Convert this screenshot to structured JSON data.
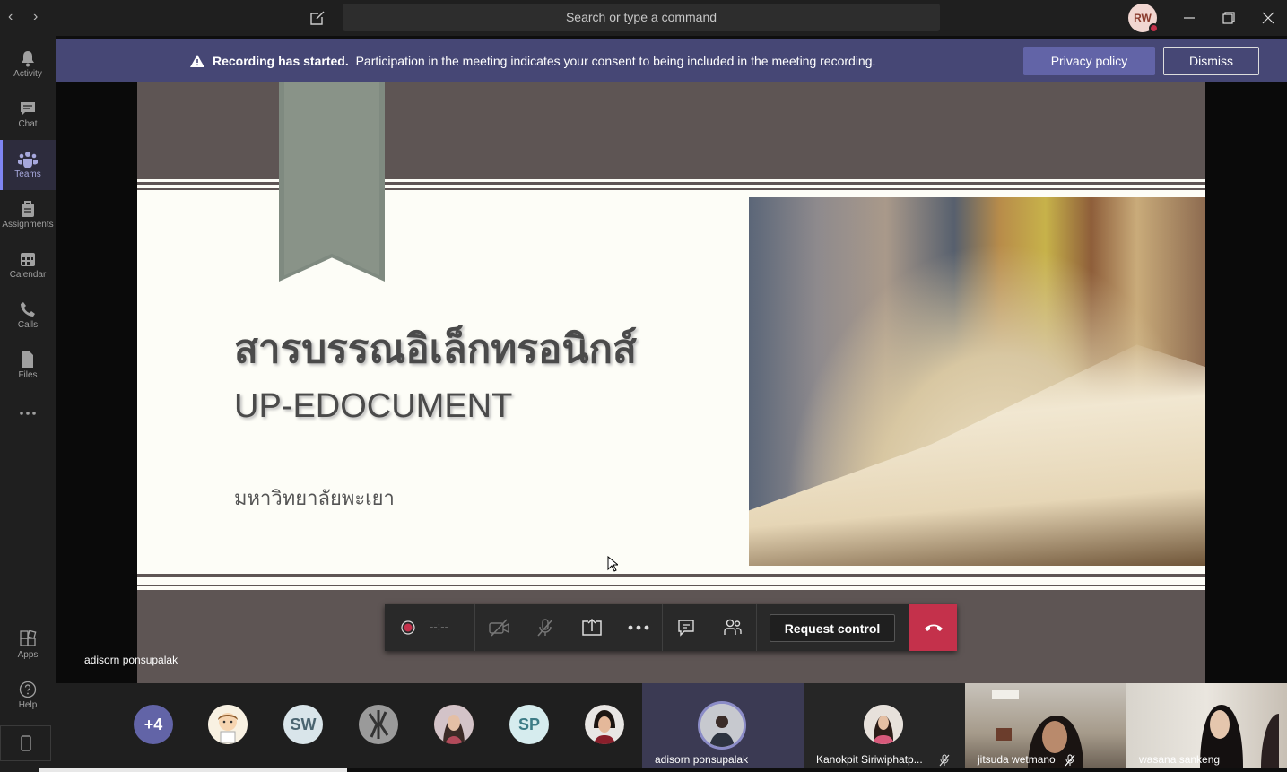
{
  "titlebar": {
    "search_placeholder": "Search or type a command",
    "user_initials": "RW"
  },
  "rail": {
    "items": [
      {
        "label": "Activity",
        "icon": "bell-icon"
      },
      {
        "label": "Chat",
        "icon": "chat-icon"
      },
      {
        "label": "Teams",
        "icon": "teams-icon",
        "active": true
      },
      {
        "label": "Assignments",
        "icon": "assignments-icon"
      },
      {
        "label": "Calendar",
        "icon": "calendar-icon"
      },
      {
        "label": "Calls",
        "icon": "phone-icon"
      },
      {
        "label": "Files",
        "icon": "file-icon"
      }
    ],
    "apps_label": "Apps",
    "help_label": "Help"
  },
  "banner": {
    "bold": "Recording has started.",
    "text": "Participation in the meeting indicates your consent to being included in the meeting recording.",
    "privacy_label": "Privacy policy",
    "dismiss_label": "Dismiss"
  },
  "slide": {
    "title": "สารบรรณอิเล็กทรอนิกส์",
    "subtitle": "UP-EDOCUMENT",
    "org": "มหาวิทยาลัยพะเยา"
  },
  "presenter": "adisorn ponsupalak",
  "controls": {
    "timer": "--:--",
    "request_control_label": "Request control"
  },
  "participants": {
    "overflow": "+4",
    "avatars": [
      {
        "initials": "",
        "bg": "#e8d7b5"
      },
      {
        "initials": "SW",
        "bg": "#d7e3e8"
      },
      {
        "initials": "",
        "bg": "#6b6b6b"
      },
      {
        "initials": "",
        "bg": "#b88a7a"
      },
      {
        "initials": "SP",
        "bg": "#d3e8ea"
      },
      {
        "initials": "",
        "bg": "#4a3a34"
      }
    ],
    "tiles": [
      {
        "name": "adisorn ponsupalak"
      },
      {
        "name": "Kanokpit Siriwiphatp..."
      },
      {
        "name": "jitsuda wetmano"
      },
      {
        "name": "wasana sankeng"
      }
    ]
  },
  "colors": {
    "accent": "#6264a7",
    "banner": "#464775",
    "hangup": "#c4314b"
  }
}
